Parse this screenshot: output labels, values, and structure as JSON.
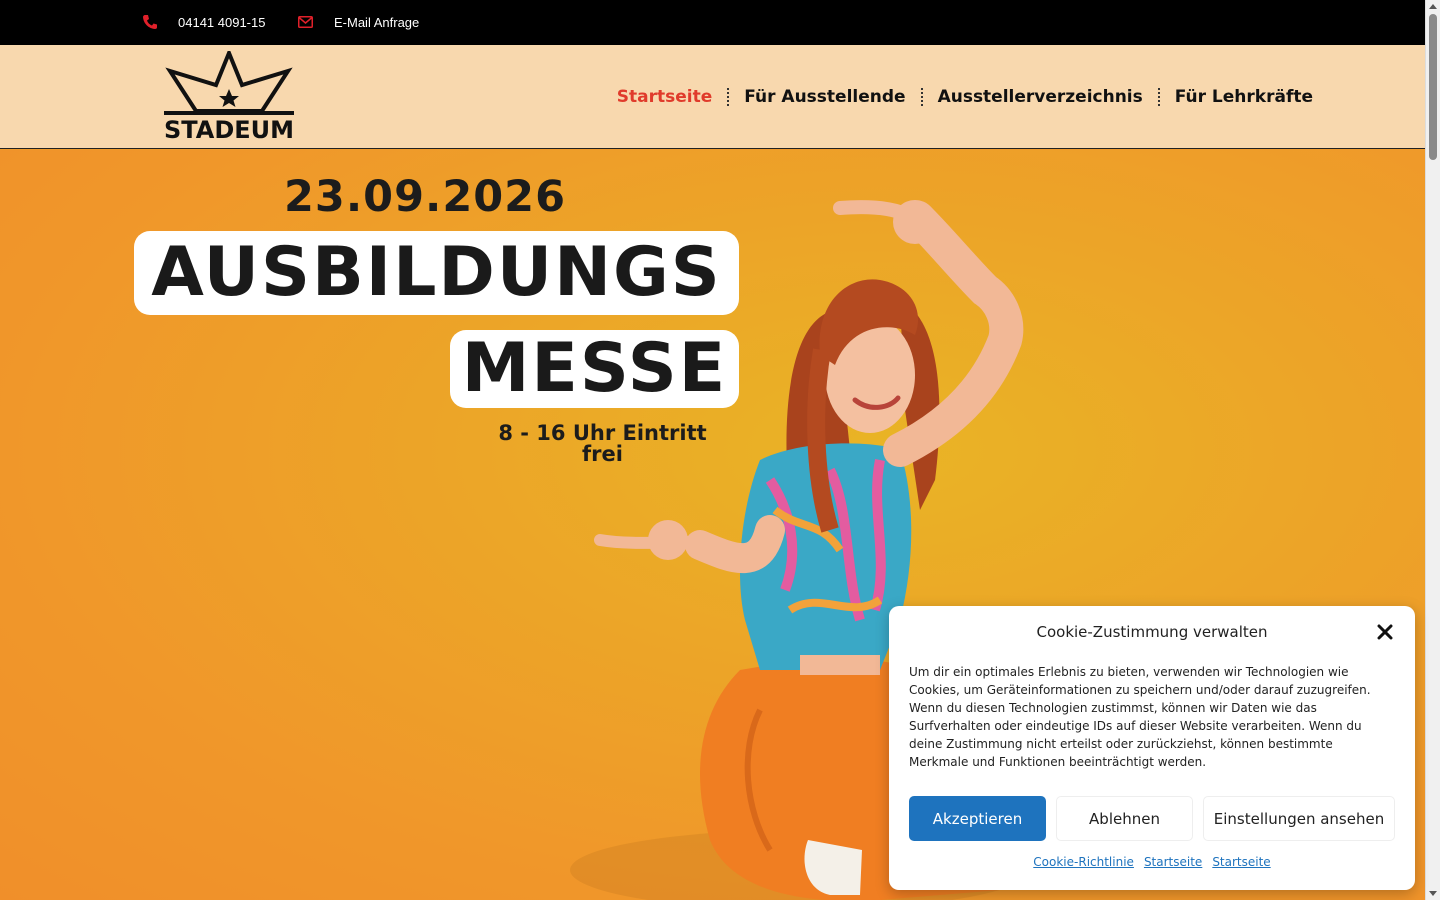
{
  "topbar": {
    "phone_icon": "phone-icon",
    "phone": "04141 4091-15",
    "mail_icon": "envelope-icon",
    "mail_label": "E-Mail Anfrage"
  },
  "header": {
    "logo_text": "STADEUM",
    "nav": [
      {
        "label": "Startseite",
        "active": true
      },
      {
        "label": "Für Ausstellende",
        "active": false
      },
      {
        "label": "Ausstellerverzeichnis",
        "active": false
      },
      {
        "label": "Für Lehrkräfte",
        "active": false
      }
    ]
  },
  "hero": {
    "date": "23.09.2026",
    "title_line1": "AUSBILDUNGS",
    "title_line2": "MESSE",
    "time_line1": "8 - 16 Uhr Eintritt",
    "time_line2": "frei"
  },
  "cookie": {
    "title": "Cookie-Zustimmung verwalten",
    "body": "Um dir ein optimales Erlebnis zu bieten, verwenden wir Technologien wie Cookies, um Geräteinformationen zu speichern und/oder darauf zuzugreifen. Wenn du diesen Technologien zustimmst, können wir Daten wie das Surfverhalten oder eindeutige IDs auf dieser Website verarbeiten. Wenn du deine Zustimmung nicht erteilst oder zurückziehst, können bestimmte Merkmale und Funktionen beeinträchtigt werden.",
    "accept": "Akzeptieren",
    "deny": "Ablehnen",
    "settings": "Einstellungen ansehen",
    "links": [
      "Cookie-Richtlinie",
      "Startseite",
      "Startseite"
    ]
  },
  "colors": {
    "accent": "#e03b2b",
    "button_blue": "#1e73be",
    "header_bg": "#f8d8ae",
    "hero_bg": "#f09a2a"
  }
}
